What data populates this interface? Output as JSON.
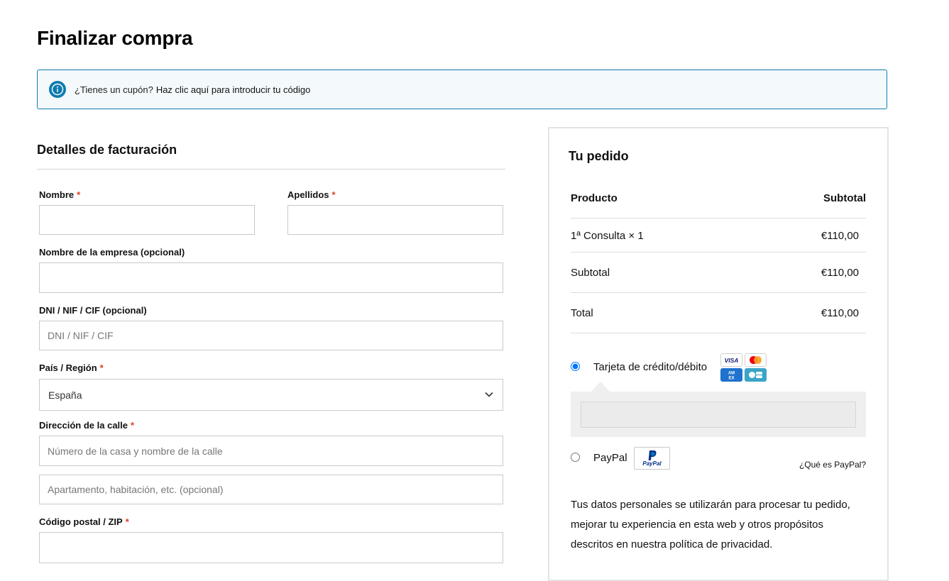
{
  "page": {
    "title": "Finalizar compra"
  },
  "coupon": {
    "text": "¿Tienes un cupón?",
    "link": "Haz clic aquí para introducir tu código"
  },
  "billing": {
    "title": "Detalles de facturación",
    "required_marker": "*",
    "fields": {
      "first_name": {
        "label": "Nombre",
        "value": ""
      },
      "last_name": {
        "label": "Apellidos",
        "value": ""
      },
      "company": {
        "label": "Nombre de la empresa (opcional)",
        "value": ""
      },
      "tax_id": {
        "label": "DNI / NIF / CIF (opcional)",
        "placeholder": "DNI / NIF / CIF",
        "value": ""
      },
      "country": {
        "label": "País / Región",
        "value": "España"
      },
      "street": {
        "label": "Dirección de la calle",
        "placeholder": "Número de la casa y nombre de la calle",
        "placeholder2": "Apartamento, habitación, etc. (opcional)"
      },
      "postcode": {
        "label": "Código postal / ZIP",
        "value": ""
      }
    }
  },
  "order": {
    "title": "Tu pedido",
    "header": {
      "product": "Producto",
      "subtotal": "Subtotal"
    },
    "item": {
      "name": "1ª Consulta × 1",
      "price": "€110,00"
    },
    "subtotal": {
      "label": "Subtotal",
      "value": "€110,00"
    },
    "total": {
      "label": "Total",
      "value": "€110,00"
    },
    "payment": {
      "card": {
        "label": "Tarjeta de crédito/débito",
        "selected": true,
        "brands": [
          "VISA",
          "Mastercard",
          "AMEX",
          "CB"
        ]
      },
      "paypal": {
        "label": "PayPal",
        "badge": "PayPal",
        "info_link": "¿Qué es PayPal?",
        "selected": false
      }
    },
    "privacy_text": "Tus datos personales se utilizarán para procesar tu pedido, mejorar tu experiencia en esta web y otros propósitos descritos en nuestra política de privacidad."
  },
  "colors": {
    "accent": "#0e7bb0",
    "required": "#e2401c",
    "border": "#c9c9c9",
    "card_area": "#efefef"
  }
}
